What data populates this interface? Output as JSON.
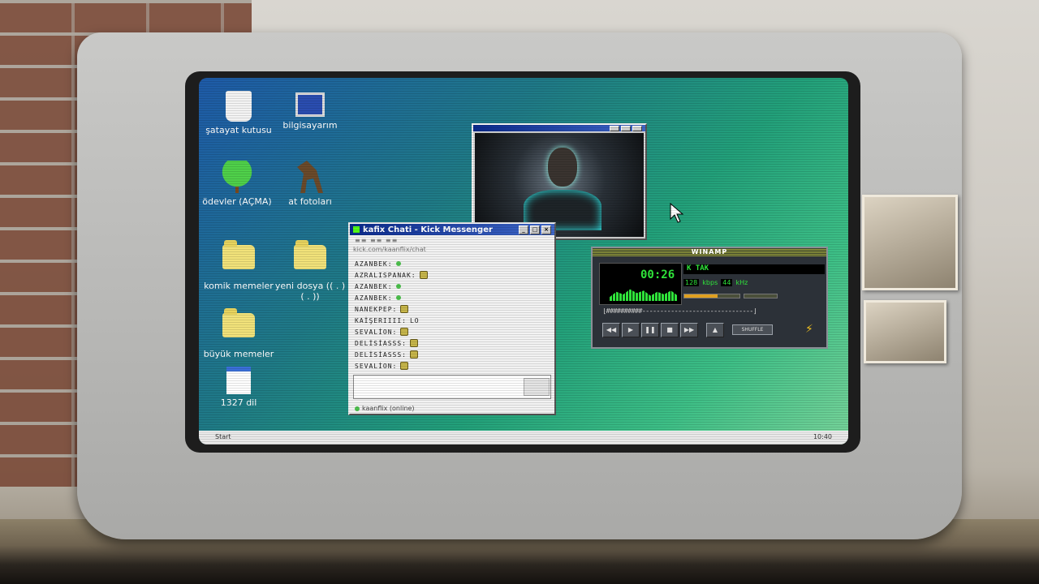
{
  "desktop": {
    "icons": [
      {
        "label": "şatayat kutusu"
      },
      {
        "label": "bilgisayarım"
      },
      {
        "label": "ödevler (AÇMA)"
      },
      {
        "label": "at fotoları"
      },
      {
        "label": "komik memeler"
      },
      {
        "label": "yeni dosya ((  .  ) (  .  ))"
      },
      {
        "label": "büyük memeler"
      },
      {
        "label": "1327 dil"
      }
    ]
  },
  "chat": {
    "title": "kafix Chati - Kick Messenger",
    "url": "kick.com/kaanflix/chat",
    "menu": "≡≡  ≡≡  ≡≡",
    "messages": [
      {
        "user": "AZANBEK:"
      },
      {
        "user": "AZRALISPANAK:"
      },
      {
        "user": "AZANBEK:"
      },
      {
        "user": "AZANBEK:"
      },
      {
        "user": "NANEKPEP:"
      },
      {
        "user": "KAİŞERIIII:",
        "text": "LO"
      },
      {
        "user": "SEVALİON:"
      },
      {
        "user": "DELİSİASSS:"
      },
      {
        "user": "DELİSİASSS:"
      },
      {
        "user": "SEVALİON:"
      }
    ],
    "status": "kaanflix (online)"
  },
  "winamp": {
    "title": "WINAMP",
    "time": "00:26",
    "song": "K TAK",
    "kbps": "128",
    "kbps_unit": "kbps",
    "khz": "44",
    "khz_unit": "kHz",
    "seek": "[##########-------------------------------]",
    "shuffle": "SHUFFLE"
  },
  "taskbar": {
    "start": "Start",
    "clock": "10:40"
  },
  "colors": {
    "titlebar": "#0b2a8c",
    "winamp_lcd": "#2fe33a"
  }
}
